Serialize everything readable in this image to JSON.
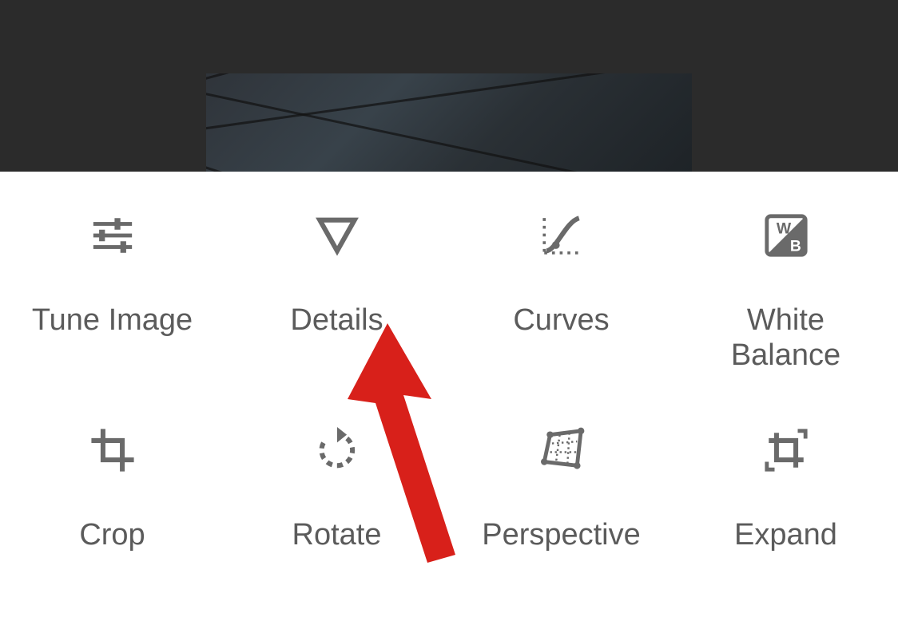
{
  "tools": [
    {
      "id": "tune",
      "label": "Tune Image",
      "icon": "tune-icon"
    },
    {
      "id": "details",
      "label": "Details",
      "icon": "details-icon"
    },
    {
      "id": "curves",
      "label": "Curves",
      "icon": "curves-icon"
    },
    {
      "id": "wb",
      "label": "White\nBalance",
      "icon": "white-balance-icon"
    },
    {
      "id": "crop",
      "label": "Crop",
      "icon": "crop-icon"
    },
    {
      "id": "rotate",
      "label": "Rotate",
      "icon": "rotate-icon"
    },
    {
      "id": "perspective",
      "label": "Perspective",
      "icon": "perspective-icon"
    },
    {
      "id": "expand",
      "label": "Expand",
      "icon": "expand-icon"
    }
  ],
  "annotation": {
    "type": "arrow",
    "target": "details",
    "color": "#d8201a"
  },
  "colors": {
    "icon": "#6a6a6a",
    "label": "#5b5b5b",
    "panel": "#ffffff",
    "arrow": "#d8201a"
  }
}
